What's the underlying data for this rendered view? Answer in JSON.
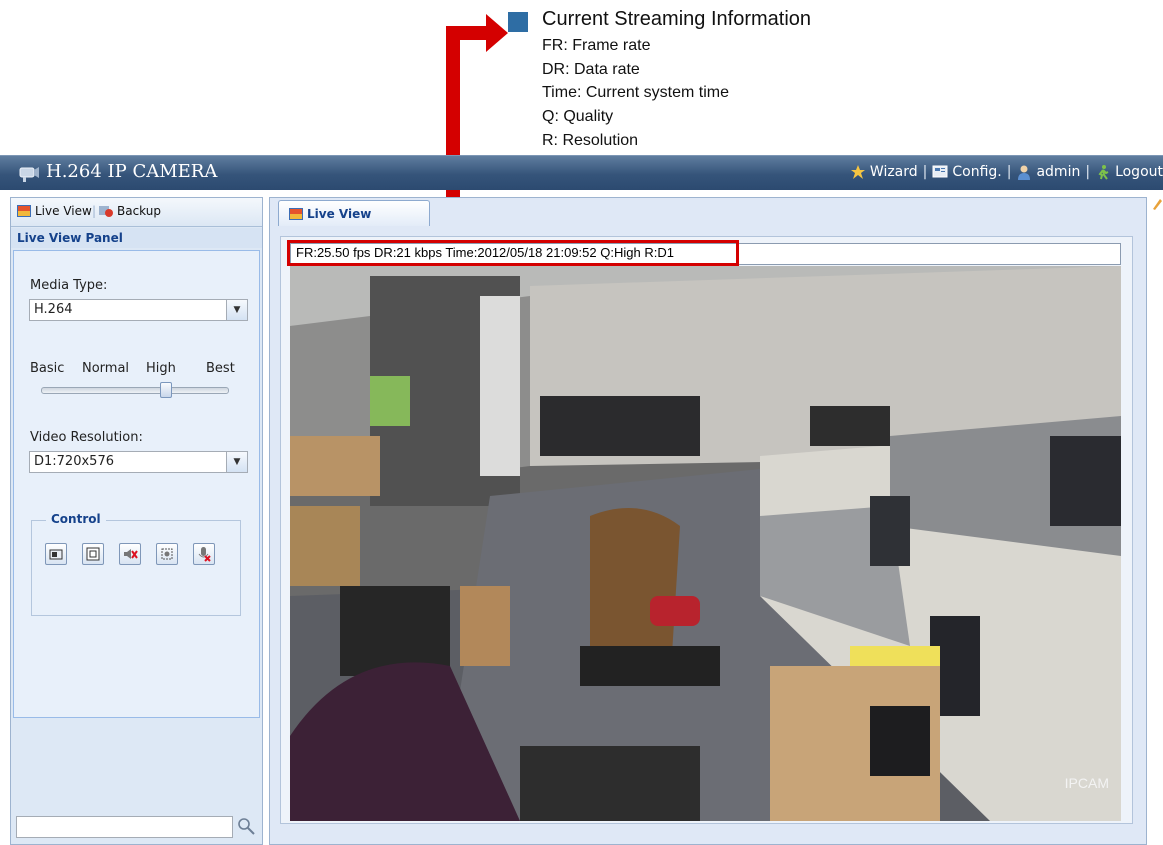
{
  "annotation": {
    "legend_title": "Current Streaming Information",
    "lines": [
      "FR: Frame rate",
      "DR: Data rate",
      "Time: Current system time",
      "Q: Quality",
      "R: Resolution"
    ],
    "marker_color": "#2e6da4",
    "arrow_color": "#d40000"
  },
  "header": {
    "title": "H.264 IP CAMERA",
    "nav": {
      "wizard": "Wizard",
      "config": "Config.",
      "user": "admin",
      "logout": "Logout"
    }
  },
  "left": {
    "tabs": {
      "live_view": "Live View",
      "backup": "Backup"
    },
    "panel_title": "Live View Panel",
    "media_type_label": "Media Type:",
    "media_type_value": "H.264",
    "quality_labels": [
      "Basic",
      "Normal",
      "High",
      "Best"
    ],
    "quality_level": 0.67,
    "resolution_label": "Video Resolution:",
    "resolution_value": "D1:720x576",
    "control_legend": "Control",
    "control_icons": [
      "snapshot-icon",
      "fullscreen-icon",
      "speaker-mute-icon",
      "zoom-icon",
      "microphone-mute-icon"
    ],
    "search_value": ""
  },
  "right": {
    "tab": "Live View",
    "info": "FR:25.50 fps  DR:21 kbps Time:2012/05/18 21:09:52 Q:High R:D1",
    "osd": "IPCAM"
  },
  "colors": {
    "header_bg": "#35547a",
    "panel_bg": "#dde8f5",
    "panel_title": "#15428b"
  }
}
